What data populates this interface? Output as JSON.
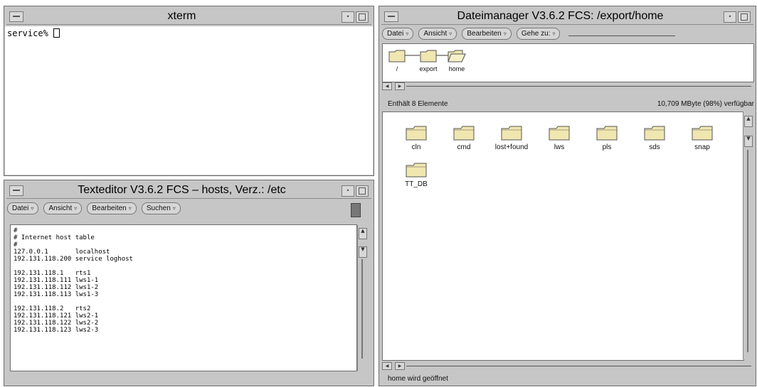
{
  "xterm": {
    "title": "xterm",
    "prompt": "service% "
  },
  "texteditor": {
    "title": "Texteditor V3.6.2 FCS – hosts, Verz.: /etc",
    "menus": [
      "Datei",
      "Ansicht",
      "Bearbeiten",
      "Suchen"
    ],
    "lines": [
      "#",
      "# Internet host table",
      "#",
      "127.0.0.1       localhost",
      "192.131.118.200 service loghost",
      "",
      "192.131.118.1   rts1",
      "192.131.118.111 lws1-1",
      "192.131.118.112 lws1-2",
      "192.131.118.113 lws1-3",
      "",
      "192.131.118.2   rts2",
      "192.131.118.121 lws2-1",
      "192.131.118.122 lws2-2",
      "192.131.118.123 lws2-3"
    ]
  },
  "filemanager": {
    "title": "Dateimanager V3.6.2 FCS: /export/home",
    "menus": [
      "Datei",
      "Ansicht",
      "Bearbeiten",
      "Gehe zu:"
    ],
    "path": [
      "/",
      "export",
      "home"
    ],
    "count_text": "Enthält 8 Elemente",
    "free_text": "10,709 MByte (98%) verfügbar",
    "folders": [
      "cln",
      "cmd",
      "lost+found",
      "lws",
      "pls",
      "sds",
      "snap",
      "TT_DB"
    ],
    "status": "home wird geöffnet"
  },
  "icons": {
    "menu_arrow": "▿",
    "scroll_up": "▲",
    "scroll_down": "▼"
  },
  "colors": {
    "window_bg": "#c6c6c6",
    "folder_fill": "#f0e6b0",
    "folder_stroke": "#555555"
  }
}
